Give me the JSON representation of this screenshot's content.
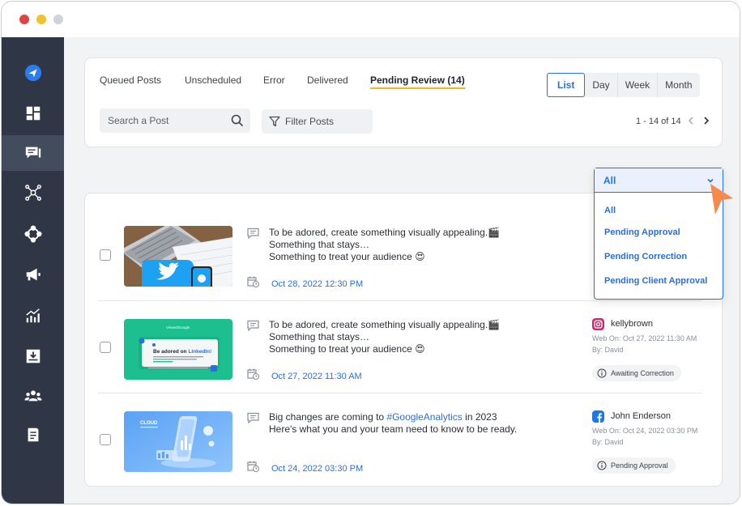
{
  "tabs": [
    {
      "label": "Queued Posts"
    },
    {
      "label": "Unscheduled"
    },
    {
      "label": "Error"
    },
    {
      "label": "Delivered"
    },
    {
      "label": "Pending Review (14)",
      "active": true
    }
  ],
  "views": [
    {
      "label": "List",
      "active": true
    },
    {
      "label": "Day"
    },
    {
      "label": "Week"
    },
    {
      "label": "Month"
    }
  ],
  "search": {
    "placeholder": "Search a Post",
    "value": ""
  },
  "filter": {
    "label": "Filter Posts"
  },
  "pagination": {
    "text": "1 - 14 of 14"
  },
  "status_filter": {
    "selected": "All",
    "options": [
      "All",
      "Pending Approval",
      "Pending Correction",
      "Pending Client Approval"
    ]
  },
  "posts": [
    {
      "lines": [
        "To be adored, create something visually appealing.🎬",
        "Something that stays…",
        "Something to treat your audience 😍"
      ],
      "date": "Oct 28, 2022 12:30 PM",
      "thumbnail": "twitter-laptop"
    },
    {
      "lines": [
        "To be adored, create something visually appealing.🎬",
        "Something that stays…",
        "Something to treat your audience 😍"
      ],
      "date": "Oct 27, 2022 11:30 AM",
      "thumbnail": "linkedin-card",
      "thumb_text": {
        "brand": "ViewedGoogle",
        "headline": "Be adored on ",
        "headline_tag": "LinkedIn!"
      },
      "account": {
        "network": "instagram",
        "name": "kellybrown",
        "web_on": "Web On: Oct 27, 2022 11:30 AM",
        "by": "By: David"
      },
      "status": "Awaiting Correction"
    },
    {
      "line1": {
        "before": "Big changes are coming to ",
        "tag": "#GoogleAnalytics",
        "after": " in 2023"
      },
      "line2": "Here's what you and your team need to know to be ready.",
      "date": "Oct 24, 2022 03:30 PM",
      "thumbnail": "cloud-phone",
      "thumb_text": {
        "title": "CLOUD"
      },
      "account": {
        "network": "facebook",
        "name": "John Enderson",
        "web_on": "Web On: Oct 24, 2022 03:30 PM",
        "by": "By: David"
      },
      "status": "Pending Approval"
    }
  ],
  "colors": {
    "accent": "#2a6fdb",
    "sidebar": "#2f3746",
    "tab_underline": "#f6b51e",
    "cursor": "#f58a4b",
    "twitter": "#1da1f2",
    "linkedin_bg": "#1dbf8f",
    "instagram": "#d6246e",
    "facebook": "#1877f2"
  },
  "sidebar_icons": [
    "send-logo-icon",
    "dashboard-icon",
    "posts-icon",
    "network-icon",
    "share-icon",
    "megaphone-icon",
    "analytics-icon",
    "download-icon",
    "users-icon",
    "reports-icon"
  ]
}
